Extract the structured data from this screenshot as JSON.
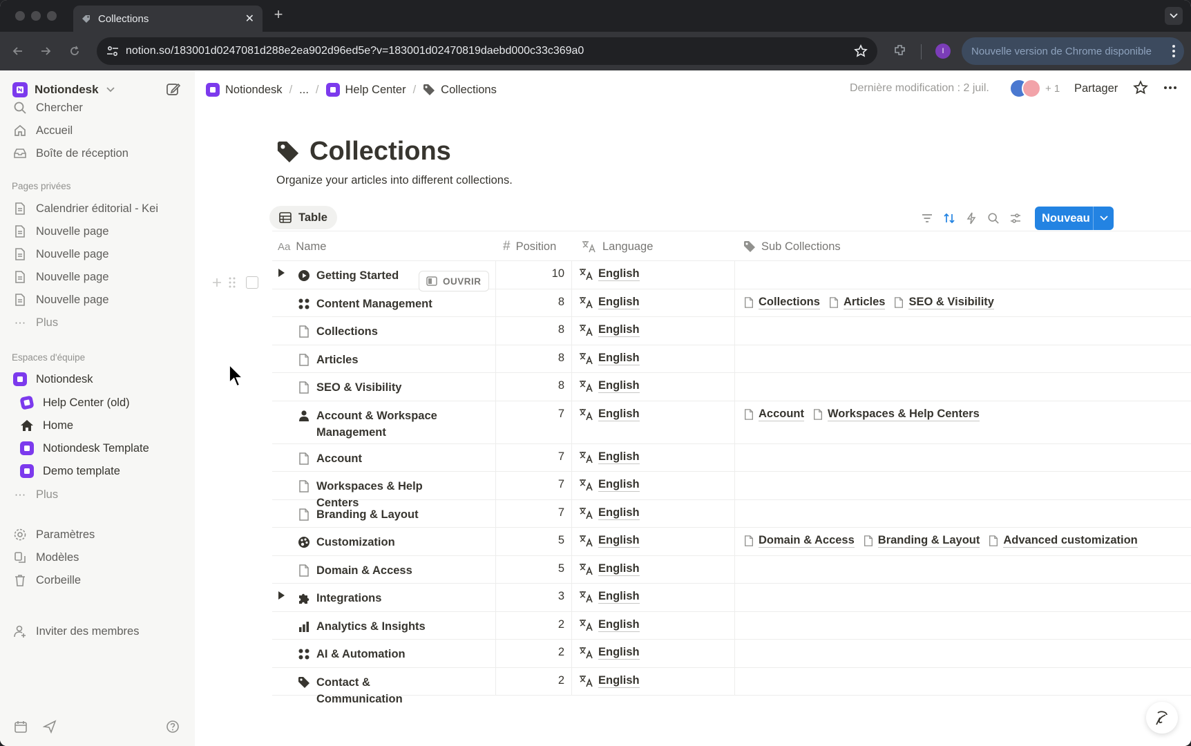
{
  "browser": {
    "tab_title": "Collections",
    "url": "notion.so/183001d0247081d288e2ea902d96ed5e?v=183001d02470819daebd000c33c369a0",
    "update_text": "Nouvelle version de Chrome disponible",
    "profile_initial": "I"
  },
  "sidebar": {
    "workspace": "Notiondesk",
    "top_items": [
      {
        "label": "Chercher",
        "icon": "search-icon"
      },
      {
        "label": "Accueil",
        "icon": "home-icon"
      },
      {
        "label": "Boîte de réception",
        "icon": "inbox-icon"
      }
    ],
    "private_section": "Pages privées",
    "private_pages": [
      "Calendrier éditorial - Kei",
      "Nouvelle page",
      "Nouvelle page",
      "Nouvelle page",
      "Nouvelle page"
    ],
    "more_label": "Plus",
    "team_section": "Espaces d'équipe",
    "team_workspace": "Notiondesk",
    "team_pages": [
      "Help Center (old)",
      "Home",
      "Notiondesk Template",
      "Demo template"
    ],
    "team_more": "Plus",
    "bottom_items": [
      {
        "label": "Paramètres",
        "icon": "settings-icon"
      },
      {
        "label": "Modèles",
        "icon": "templates-icon"
      },
      {
        "label": "Corbeille",
        "icon": "trash-icon"
      }
    ],
    "invite": "Inviter des membres"
  },
  "topbar": {
    "breadcrumbs": [
      "Notiondesk",
      "...",
      "Help Center",
      "Collections"
    ],
    "last_modified": "Dernière modification : 2 juil.",
    "extra_users": "+ 1",
    "share": "Partager"
  },
  "page": {
    "title": "Collections",
    "description": "Organize your articles into different collections.",
    "view_tab": "Table",
    "new_button": "Nouveau",
    "open_button": "OUVRIR",
    "columns": {
      "name": "Name",
      "position": "Position",
      "language": "Language",
      "sub": "Sub Collections"
    },
    "rows": [
      {
        "name": "Getting Started",
        "icon": "play-circle",
        "pos": "10",
        "lang": "English",
        "subs": [],
        "toggle": true
      },
      {
        "name": "Content Management",
        "icon": "grid",
        "pos": "8",
        "lang": "English",
        "subs": [
          "Collections",
          "Articles",
          "SEO & Visibility"
        ],
        "toggle": false
      },
      {
        "name": "Collections",
        "icon": "page",
        "pos": "8",
        "lang": "English",
        "subs": [],
        "toggle": false
      },
      {
        "name": "Articles",
        "icon": "page",
        "pos": "8",
        "lang": "English",
        "subs": [],
        "toggle": false
      },
      {
        "name": "SEO & Visibility",
        "icon": "page",
        "pos": "8",
        "lang": "English",
        "subs": [],
        "toggle": false
      },
      {
        "name": "Account & Workspace Management",
        "icon": "user",
        "pos": "7",
        "lang": "English",
        "subs": [
          "Account",
          "Workspaces & Help Centers"
        ],
        "toggle": false
      },
      {
        "name": "Account",
        "icon": "page",
        "pos": "7",
        "lang": "English",
        "subs": [],
        "toggle": false
      },
      {
        "name": "Workspaces & Help Centers",
        "icon": "page",
        "pos": "7",
        "lang": "English",
        "subs": [],
        "toggle": false
      },
      {
        "name": "Branding & Layout",
        "icon": "page",
        "pos": "7",
        "lang": "English",
        "subs": [],
        "toggle": false
      },
      {
        "name": "Customization",
        "icon": "palette",
        "pos": "5",
        "lang": "English",
        "subs": [
          "Domain & Access",
          "Branding & Layout",
          "Advanced customization"
        ],
        "toggle": false
      },
      {
        "name": "Domain & Access",
        "icon": "page",
        "pos": "5",
        "lang": "English",
        "subs": [],
        "toggle": false
      },
      {
        "name": "Integrations",
        "icon": "puzzle",
        "pos": "3",
        "lang": "English",
        "subs": [],
        "toggle": true
      },
      {
        "name": "Analytics & Insights",
        "icon": "bar-chart",
        "pos": "2",
        "lang": "English",
        "subs": [],
        "toggle": false
      },
      {
        "name": "AI & Automation",
        "icon": "grid",
        "pos": "2",
        "lang": "English",
        "subs": [],
        "toggle": false
      },
      {
        "name": "Contact & Communication",
        "icon": "tag",
        "pos": "2",
        "lang": "English",
        "subs": [],
        "toggle": false
      }
    ]
  }
}
